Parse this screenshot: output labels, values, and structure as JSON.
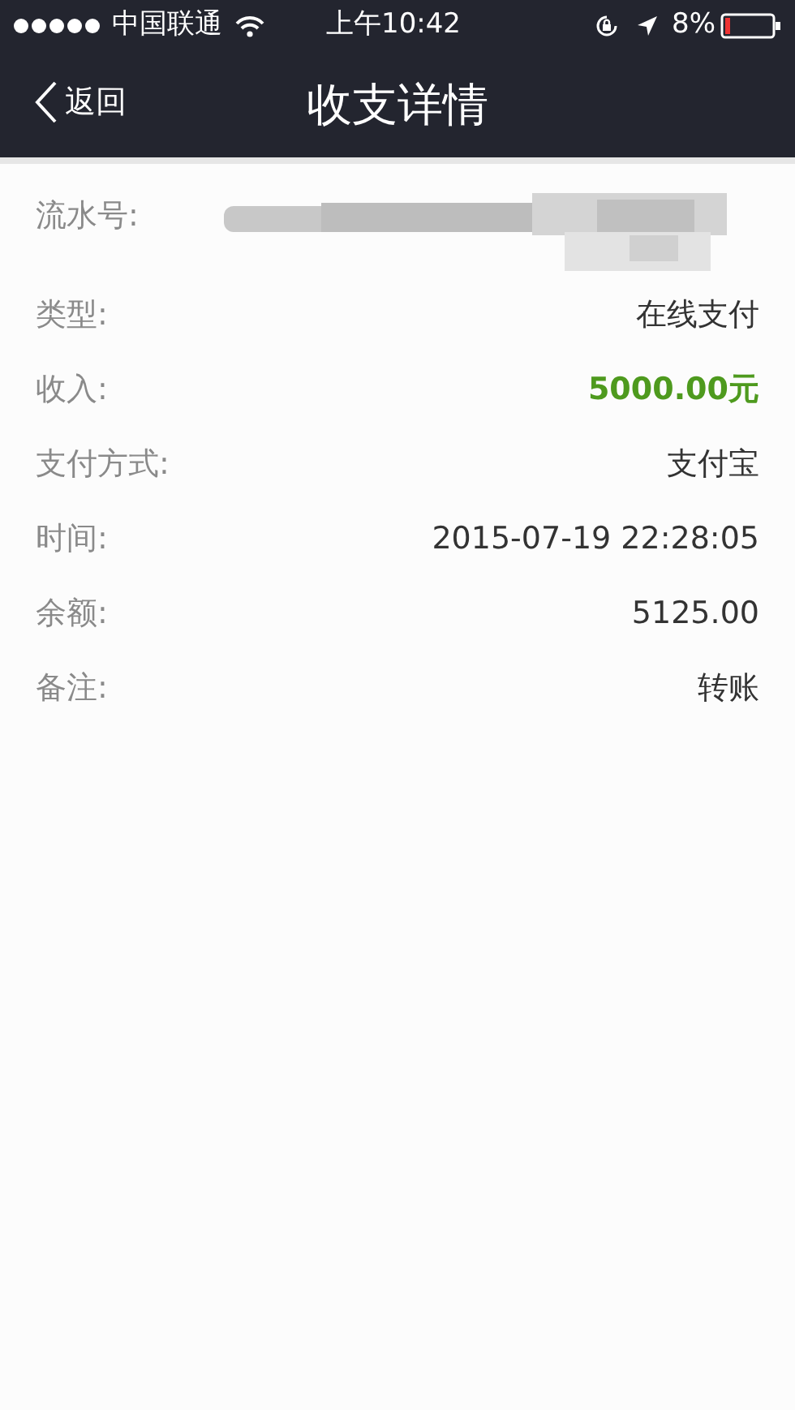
{
  "status_bar": {
    "carrier": "中国联通",
    "time": "上午10:42",
    "battery": "8%"
  },
  "nav": {
    "back": "返回",
    "title": "收支详情"
  },
  "rows": [
    {
      "kind": "redacted",
      "label": "流水号:"
    },
    {
      "kind": "plain",
      "label": "类型:",
      "value": "在线支付"
    },
    {
      "kind": "amount",
      "label": "收入:",
      "value": "5000.00元"
    },
    {
      "kind": "plain",
      "label": "支付方式:",
      "value": "支付宝"
    },
    {
      "kind": "plain",
      "label": "时间:",
      "value": "2015-07-19 22:28:05"
    },
    {
      "kind": "plain",
      "label": "余额:",
      "value": "5125.00"
    },
    {
      "kind": "plain",
      "label": "备注:",
      "value": "转账"
    }
  ]
}
